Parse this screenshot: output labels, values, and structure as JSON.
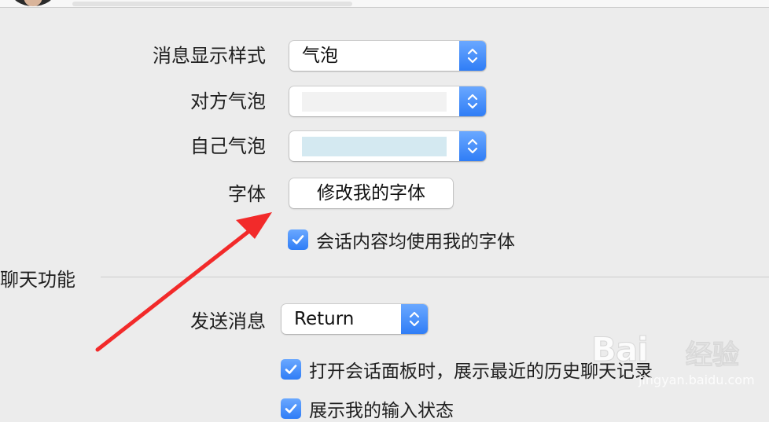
{
  "settings": {
    "bubble_style": {
      "label": "消息显示样式",
      "value": "气泡"
    },
    "other_bubble": {
      "label": "对方气泡",
      "swatch_color": "#f2f2f2"
    },
    "self_bubble": {
      "label": "自己气泡",
      "swatch_color": "#d4e9f1"
    },
    "font": {
      "label": "字体",
      "button": "修改我的字体"
    },
    "use_my_font": {
      "label": "会话内容均使用我的字体",
      "checked": true
    }
  },
  "chat_features": {
    "section_title": "聊天功能",
    "send_message": {
      "label": "发送消息",
      "value": "Return"
    },
    "show_recent_history": {
      "label": "打开会话面板时，展示最近的历史聊天记录",
      "checked": true
    },
    "show_typing_status": {
      "label": "展示我的输入状态",
      "checked": true
    }
  },
  "watermark": {
    "logo": "Bai",
    "text": "经验",
    "url": "jingyan.baidu.com"
  },
  "colors": {
    "accent": "#3b87f7",
    "annotation_arrow": "#f22a2a"
  },
  "icons": {
    "stepper": "up-down-chevron-icon",
    "check": "checkmark-icon"
  }
}
